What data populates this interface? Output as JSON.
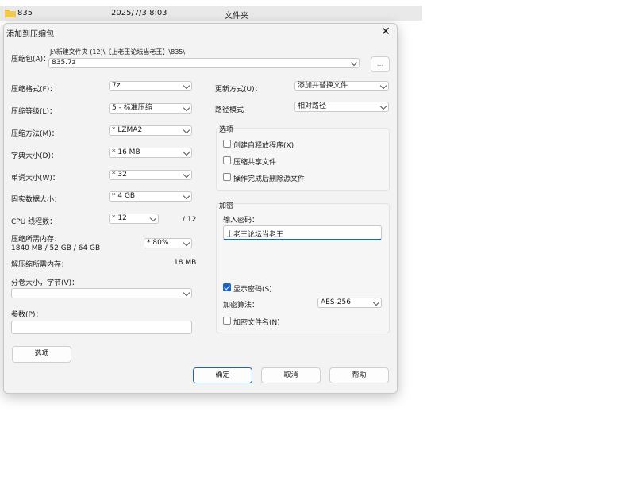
{
  "background_row": {
    "name": "835",
    "date": "2025/7/3 8:03",
    "type": "文件夹"
  },
  "dialog": {
    "title": "添加到压缩包",
    "archive_label": "压缩包(A)：",
    "archive_path": "J:\\新建文件夹 (12)\\【上老王论坛当老王】\\835\\",
    "archive_name": "835.7z",
    "browse_label": "...",
    "left": {
      "format": {
        "label": "压缩格式(F)：",
        "value": "7z"
      },
      "level": {
        "label": "压缩等级(L)：",
        "value": "5 - 标准压缩"
      },
      "method": {
        "label": "压缩方法(M)：",
        "value": "* LZMA2"
      },
      "dict": {
        "label": "字典大小(D)：",
        "value": "*  16 MB"
      },
      "word": {
        "label": "单词大小(W)：",
        "value": "*  32"
      },
      "solid": {
        "label": "固实数据大小：",
        "value": "*  4 GB"
      },
      "threads": {
        "label": "CPU 线程数：",
        "value": "*  12",
        "total": "/ 12"
      },
      "memory": {
        "label": "压缩所需内存：",
        "detail": "1840 MB / 52 GB / 64 GB",
        "value": "*  80%"
      },
      "decomp": {
        "label": "解压缩所需内存：",
        "value": "18 MB"
      },
      "split": {
        "label": "分卷大小，字节(V)：",
        "value": ""
      },
      "params": {
        "label": "参数(P)：",
        "value": ""
      },
      "options_button": "选项"
    },
    "right": {
      "update": {
        "label": "更新方式(U)：",
        "value": "添加并替换文件"
      },
      "pathmode": {
        "label": "路径模式",
        "value": "相对路径"
      },
      "options_group": {
        "title": "选项",
        "sfx": {
          "label": "创建自释放程序(X)",
          "checked": false
        },
        "shared": {
          "label": "压缩共享文件",
          "checked": false
        },
        "delete": {
          "label": "操作完成后删除源文件",
          "checked": false
        }
      },
      "encryption": {
        "title": "加密",
        "password_label": "输入密码：",
        "password_value": "上老王论坛当老王",
        "show_password": {
          "label": "显示密码(S)",
          "checked": true
        },
        "method_label": "加密算法：",
        "method_value": "AES-256",
        "encrypt_names": {
          "label": "加密文件名(N)",
          "checked": false
        }
      }
    },
    "buttons": {
      "ok": "确定",
      "cancel": "取消",
      "help": "帮助"
    }
  },
  "colors": {
    "accent": "#1a63c7",
    "dialog_bg": "#f3f3f3"
  }
}
